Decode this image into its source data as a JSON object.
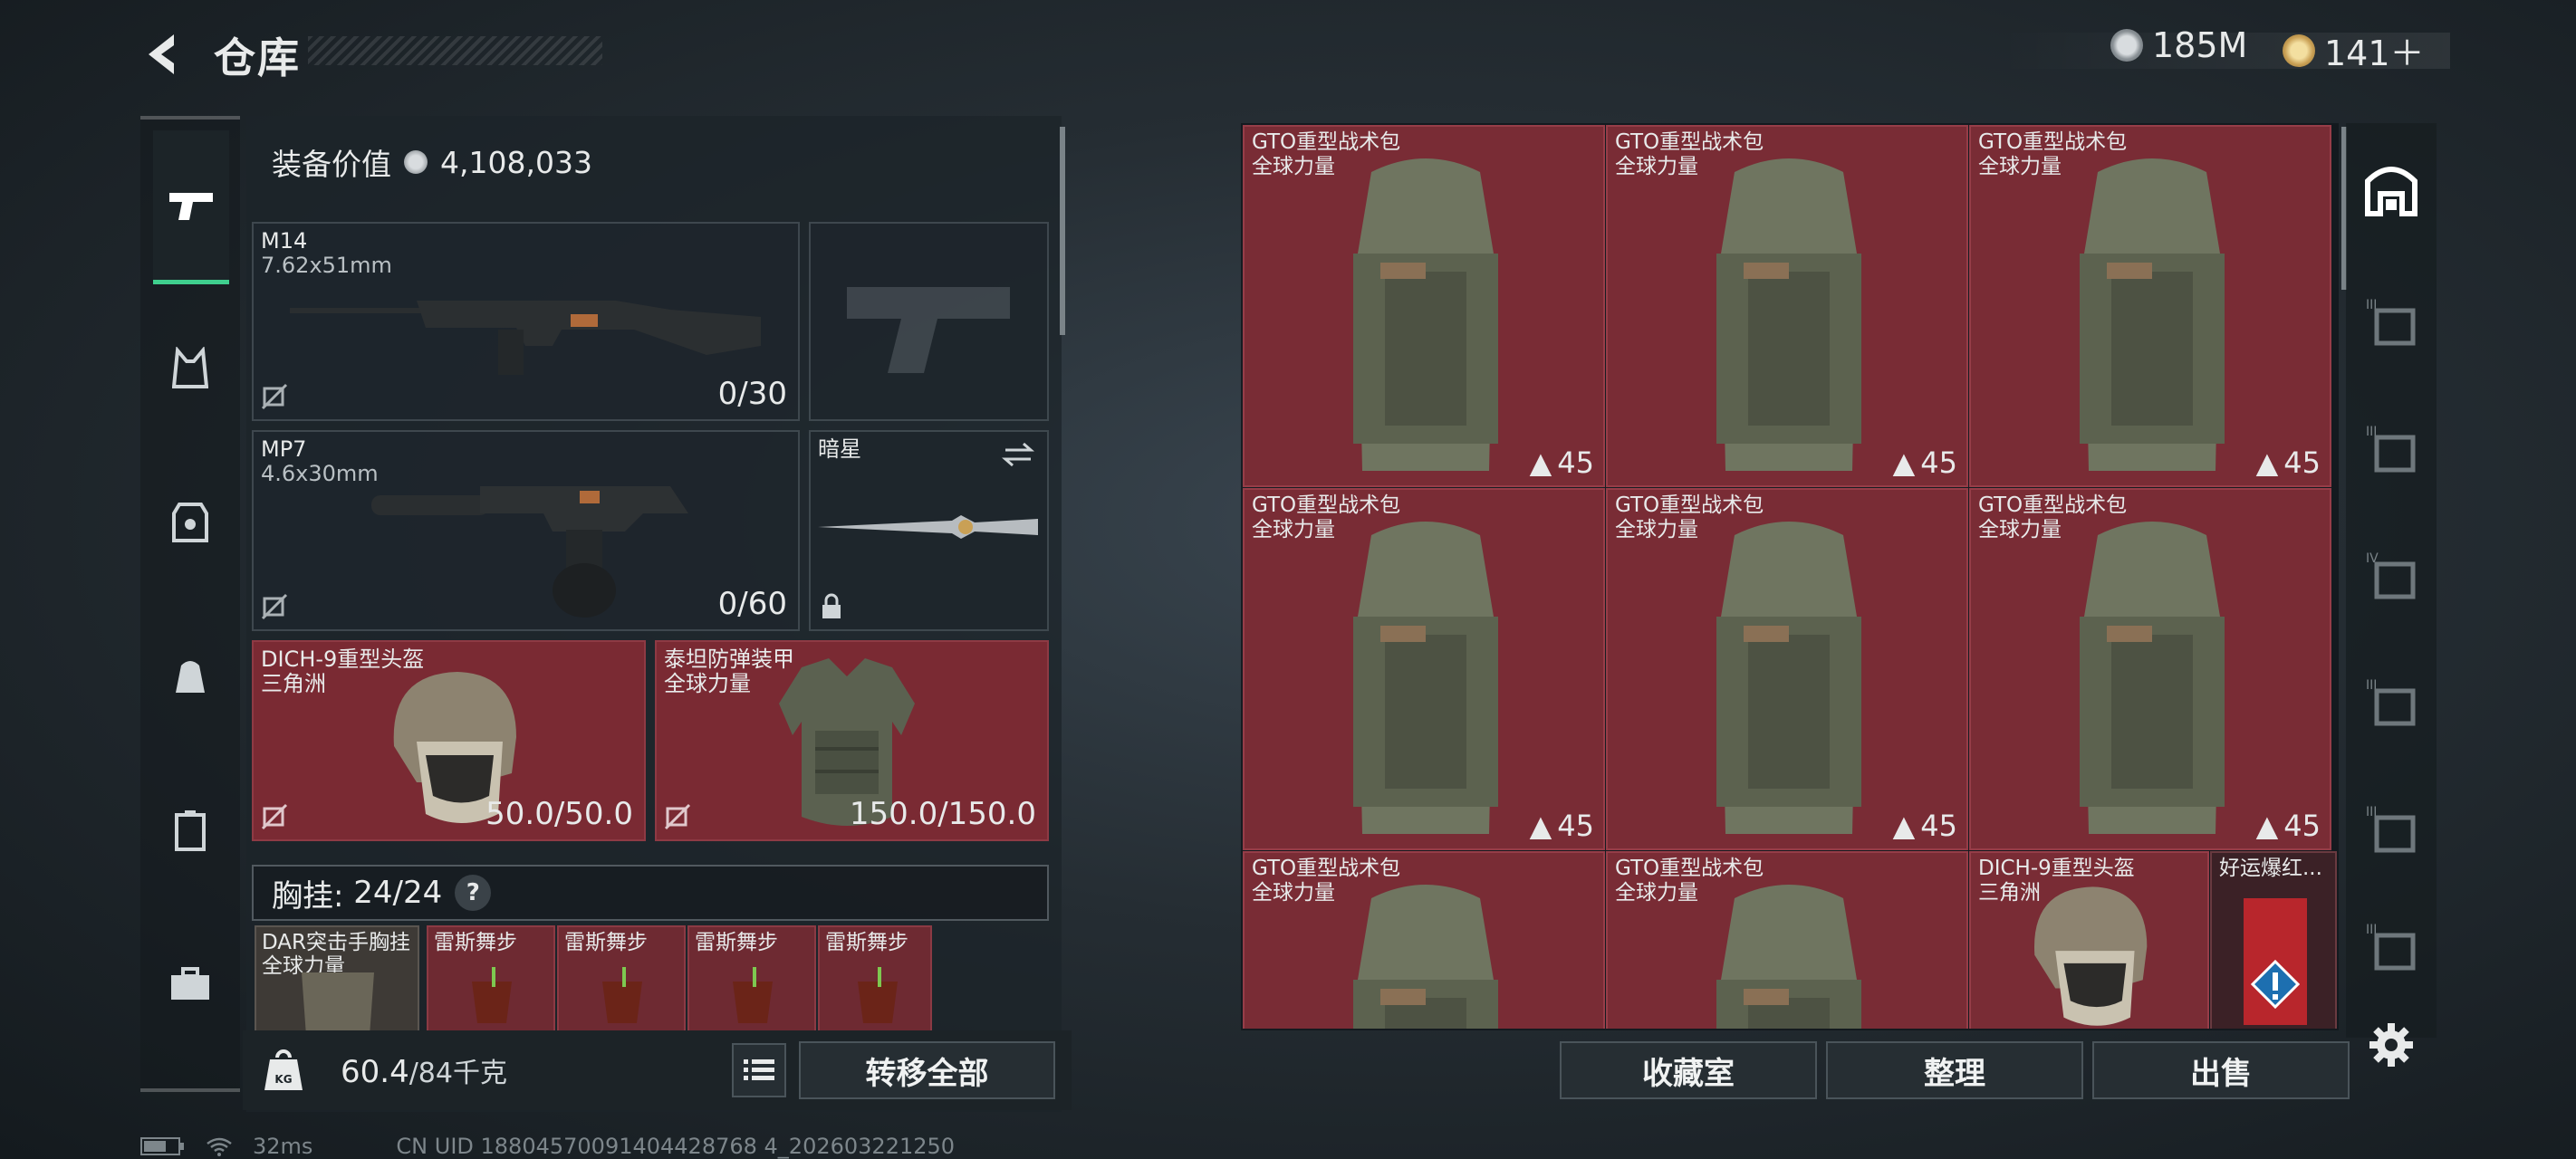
{
  "header": {
    "title": "仓库"
  },
  "currency": {
    "silver": "185M",
    "gold": "141＋"
  },
  "sidebar": {
    "items": [
      {
        "name": "pistol"
      },
      {
        "name": "vest"
      },
      {
        "name": "armor"
      },
      {
        "name": "backpack"
      },
      {
        "name": "container"
      },
      {
        "name": "case"
      }
    ]
  },
  "equipment": {
    "value_label": "装备价值",
    "value": "4,108,033",
    "primary_weapon": {
      "name": "M14",
      "caliber": "7.62x51mm",
      "ammo": "0/30"
    },
    "secondary_weapon": {
      "name": "MP7",
      "caliber": "4.6x30mm",
      "ammo": "0/60"
    },
    "melee": {
      "name": "暗星"
    },
    "helmet": {
      "name": "DICH-9重型头盔",
      "faction": "三角洲",
      "durability": "50.0/50.0"
    },
    "armor": {
      "name": "泰坦防弹装甲",
      "faction": "全球力量",
      "durability": "150.0/150.0"
    },
    "chest_rig": {
      "label": "胸挂:",
      "capacity": "24/24",
      "help": "?"
    },
    "pockets": [
      {
        "name": "DAR突击手胸挂",
        "faction": "全球力量"
      },
      {
        "name": "雷斯舞步"
      },
      {
        "name": "雷斯舞步"
      },
      {
        "name": "雷斯舞步"
      },
      {
        "name": "雷斯舞步"
      }
    ]
  },
  "bottom": {
    "weight": "60.4",
    "capacity": "/84千克",
    "transfer_all": "转移全部"
  },
  "storage": {
    "items": [
      {
        "name": "GTO重型战术包",
        "faction": "全球力量",
        "count": "45"
      },
      {
        "name": "GTO重型战术包",
        "faction": "全球力量",
        "count": "45"
      },
      {
        "name": "GTO重型战术包",
        "faction": "全球力量",
        "count": "45"
      },
      {
        "name": "GTO重型战术包",
        "faction": "全球力量",
        "count": "45"
      },
      {
        "name": "GTO重型战术包",
        "faction": "全球力量",
        "count": "45"
      },
      {
        "name": "GTO重型战术包",
        "faction": "全球力量",
        "count": "45"
      },
      {
        "name": "GTO重型战术包",
        "faction": "全球力量",
        "count": ""
      },
      {
        "name": "GTO重型战术包",
        "faction": "全球力量",
        "count": ""
      },
      {
        "name": "DICH-9重型头盔",
        "faction": "三角洲",
        "count": ""
      },
      {
        "name": "好运爆红...",
        "faction": "",
        "count": ""
      }
    ],
    "buttons": {
      "collection": "收藏室",
      "sort": "整理",
      "sell": "出售"
    }
  },
  "status": {
    "ping": "32ms",
    "uid": "CN UID 18804570091404428768 4_202603221250"
  },
  "colors": {
    "accent_green": "#3fcf8e",
    "item_red": "#792c35"
  }
}
